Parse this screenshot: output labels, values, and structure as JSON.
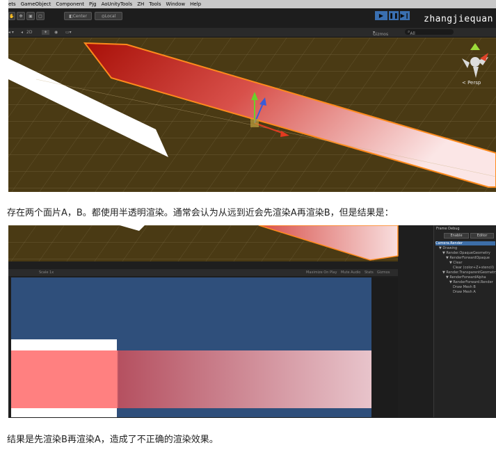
{
  "figure1": {
    "menu": [
      "ets",
      "GameObject",
      "Component",
      "Pjg",
      "AoUnityTools",
      "ZH",
      "Tools",
      "Window",
      "Help"
    ],
    "toolbar": {
      "pivot_label": "Center",
      "space_label": "Local"
    },
    "watermark": "zhangjiequan",
    "scene_bar": {
      "dim_label": "2D",
      "gizmos_label": "Gizmos",
      "search_label": "All"
    },
    "persp_label": "< Persp",
    "colors": {
      "ground": "#4a3a14",
      "quad_red": "#b2140e",
      "outline": "#ff8a1c"
    }
  },
  "caption1": "存在两个面片A，B。都使用半透明渲染。通常会认为从远到近会先渲染A再渲染B，但是结果是：",
  "figure2": {
    "game_bar": {
      "scale": "Scale 1x",
      "maximize": "Maximize On Play",
      "mute": "Mute Audio",
      "stats": "Stats",
      "gizmos": "Gizmos"
    },
    "frame_debug": {
      "title": "Frame Debug",
      "enable": "Enable",
      "editor": "Editor",
      "tree": [
        {
          "label": "Camera.Render",
          "indent": 0,
          "selected": true
        },
        {
          "label": "▼ Drawing",
          "indent": 1
        },
        {
          "label": "▼ Render.OpaqueGeometry",
          "indent": 2
        },
        {
          "label": "▼ RenderForwardOpaque",
          "indent": 3
        },
        {
          "label": "▼ Clear",
          "indent": 4
        },
        {
          "label": "Clear (color+Z+stencil)",
          "indent": 5
        },
        {
          "label": "▼ Render.TransparentGeometry",
          "indent": 2
        },
        {
          "label": "▼ RenderForwardAlpha",
          "indent": 3
        },
        {
          "label": "▼ RenderForward.Render",
          "indent": 4
        },
        {
          "label": "Draw Mesh B",
          "indent": 5
        },
        {
          "label": "Draw Mesh A",
          "indent": 5
        }
      ]
    },
    "colors": {
      "background": "#2f4f7b",
      "quad_a": "#ff8080",
      "quad_b": "#b55060"
    }
  },
  "caption2": "结果是先渲染B再渲染A，造成了不正确的渲染效果。"
}
